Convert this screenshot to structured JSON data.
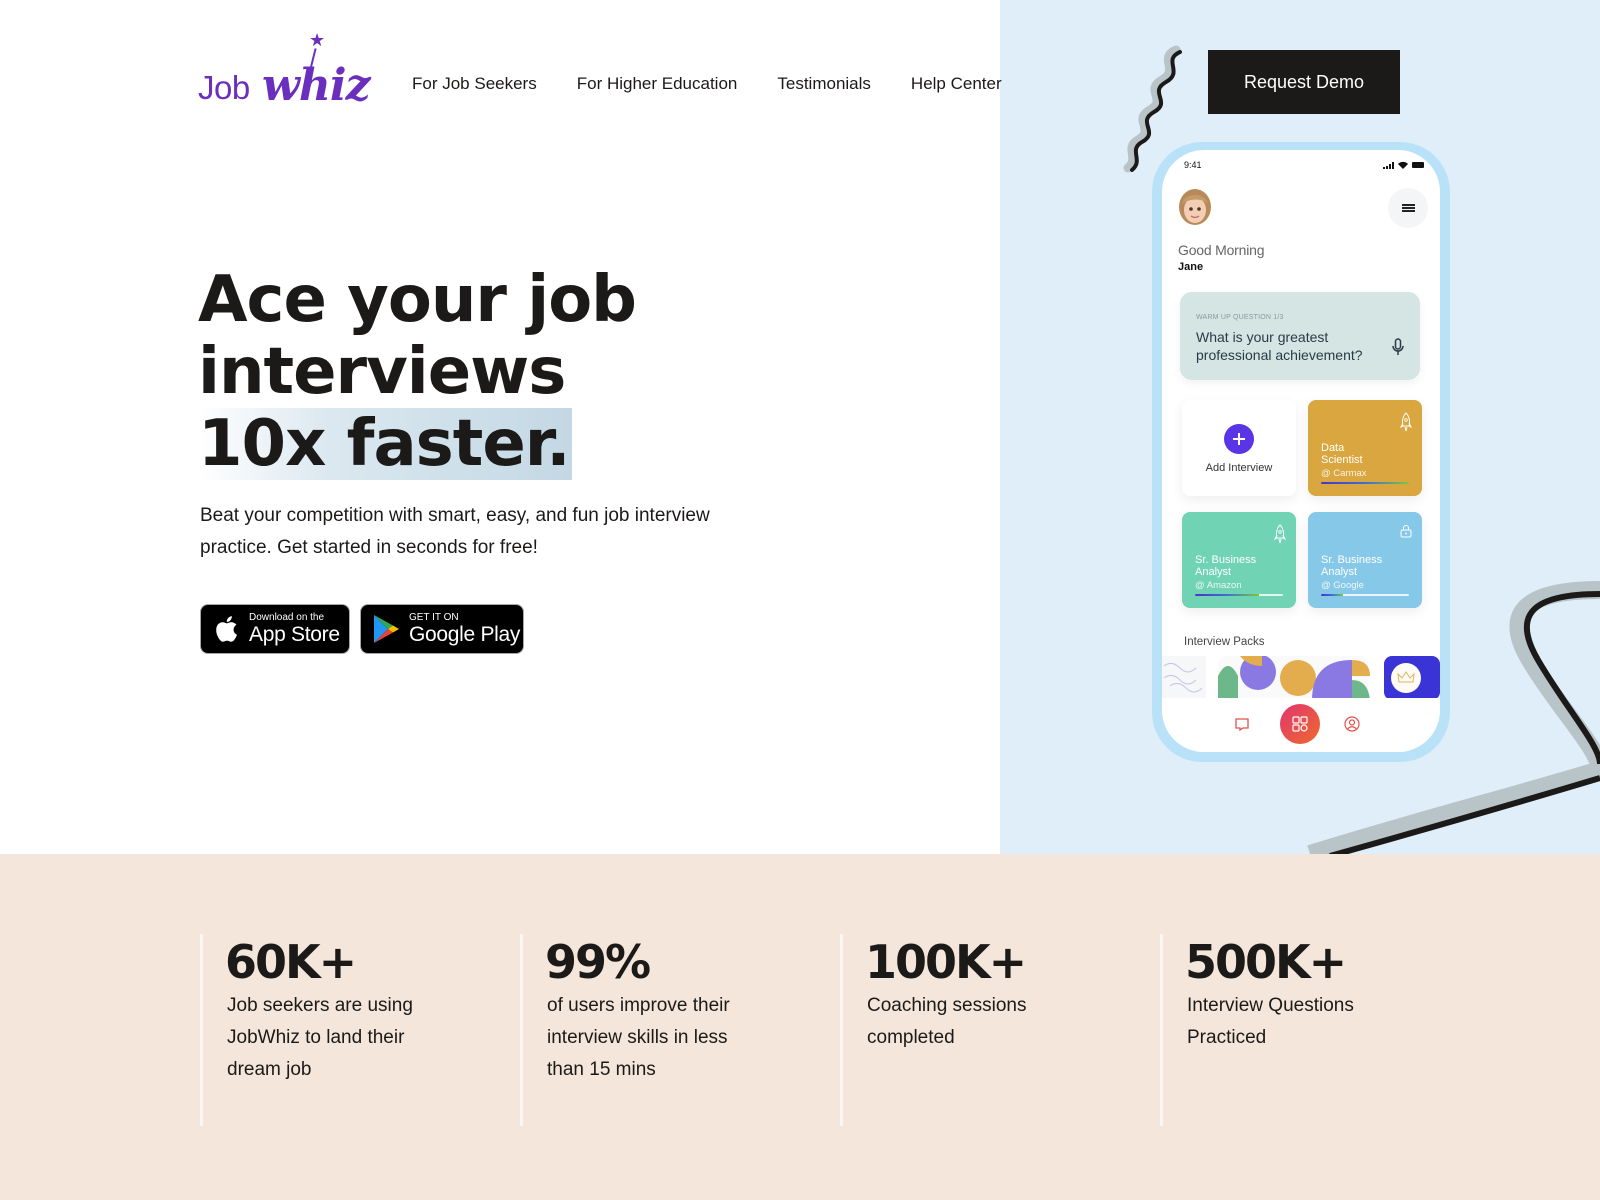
{
  "brand": {
    "logo_text_1": "Job",
    "logo_text_2": "whiz",
    "accent_color": "#6a2fbd"
  },
  "nav": {
    "items": [
      "For Job Seekers",
      "For Higher Education",
      "Testimonials",
      "Help Center"
    ],
    "cta_label": "Request Demo"
  },
  "hero": {
    "headline_line1": "Ace your job",
    "headline_line2": "interviews",
    "headline_line3": "10x faster.",
    "subtext": "Beat your competition with smart, easy, and fun job interview practice. Get started in seconds for free!",
    "app_store": {
      "small": "Download on the",
      "big": "App Store"
    },
    "google_play": {
      "small": "GET IT ON",
      "big": "Google Play"
    }
  },
  "phone": {
    "time": "9:41",
    "greeting": "Good Morning",
    "user_name": "Jane",
    "question_card": {
      "label": "WARM UP QUESTION 1/3",
      "question": "What is your greatest professional achievement?"
    },
    "add_interview_label": "Add Interview",
    "interviews": [
      {
        "title": "Data Scientist",
        "company": "@ Carmax",
        "color": "#d9a63f",
        "icon": "rocket-icon",
        "progress": 1.0
      },
      {
        "title": "Sr. Business Analyst",
        "company": "@ Amazon",
        "color": "#6fd3b4",
        "icon": "rocket-icon",
        "progress": 0.73
      },
      {
        "title": "Sr. Business Analyst",
        "company": "@ Google",
        "color": "#86c8e8",
        "icon": "lock-icon",
        "progress": 0.25
      }
    ],
    "packs_title": "Interview Packs"
  },
  "stats": [
    {
      "value": "60K+",
      "description": "Job seekers are using JobWhiz to land their dream job"
    },
    {
      "value": "99%",
      "description": "of users improve their interview skills in less than 15 mins"
    },
    {
      "value": "100K+",
      "description": "Coaching sessions completed"
    },
    {
      "value": "500K+",
      "description": "Interview Questions Practiced"
    }
  ]
}
